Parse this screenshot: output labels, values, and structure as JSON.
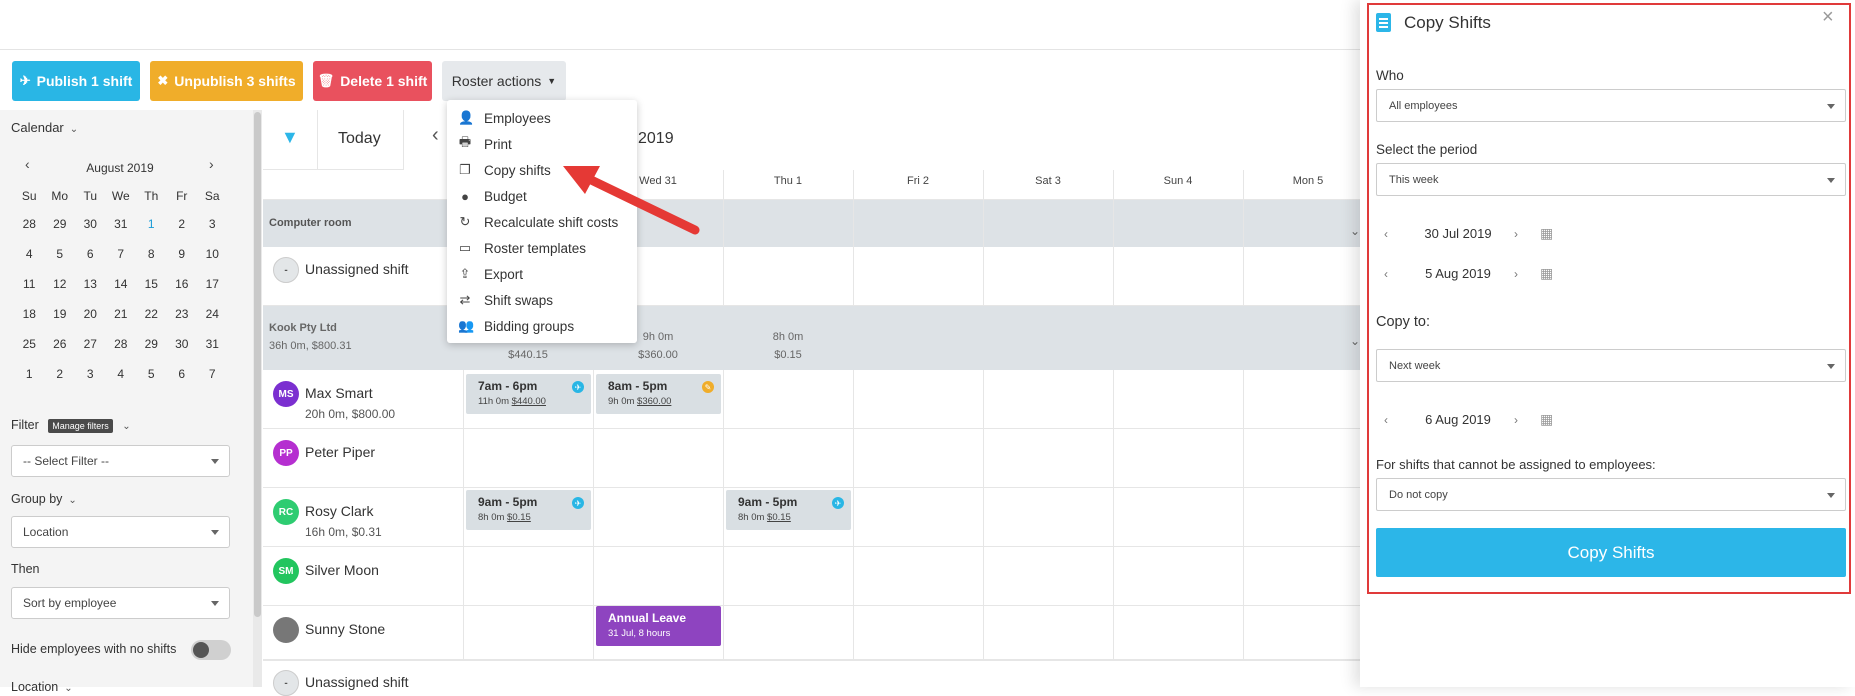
{
  "toolbar": {
    "publish_label": "Publish 1 shift",
    "unpublish_label": "Unpublish 3 shifts",
    "delete_label": "Delete 1 shift",
    "roster_actions_label": "Roster actions",
    "publish_color": "#29b6e5",
    "unpublish_color": "#f0ad2a",
    "delete_color": "#e9515e"
  },
  "roster_menu": {
    "items": [
      {
        "label": "Employees",
        "icon": "employees-icon"
      },
      {
        "label": "Print",
        "icon": "print-icon"
      },
      {
        "label": "Copy shifts",
        "icon": "copy-icon"
      },
      {
        "label": "Budget",
        "icon": "budget-icon"
      },
      {
        "label": "Recalculate shift costs",
        "icon": "refresh-icon"
      },
      {
        "label": "Roster templates",
        "icon": "calendar-icon"
      },
      {
        "label": "Export",
        "icon": "export-icon"
      },
      {
        "label": "Shift swaps",
        "icon": "swap-icon"
      },
      {
        "label": "Bidding groups",
        "icon": "group-icon"
      }
    ]
  },
  "sidebar": {
    "calendar_label": "Calendar",
    "month_label": "August 2019",
    "weekdays": [
      "Su",
      "Mo",
      "Tu",
      "We",
      "Th",
      "Fr",
      "Sa"
    ],
    "weeks": [
      [
        "28",
        "29",
        "30",
        "31",
        "1",
        "2",
        "3"
      ],
      [
        "4",
        "5",
        "6",
        "7",
        "8",
        "9",
        "10"
      ],
      [
        "11",
        "12",
        "13",
        "14",
        "15",
        "16",
        "17"
      ],
      [
        "18",
        "19",
        "20",
        "21",
        "22",
        "23",
        "24"
      ],
      [
        "25",
        "26",
        "27",
        "28",
        "29",
        "30",
        "31"
      ],
      [
        "1",
        "2",
        "3",
        "4",
        "5",
        "6",
        "7"
      ]
    ],
    "filter_label": "Filter",
    "manage_filters_label": "Manage filters",
    "filter_placeholder": "-- Select Filter --",
    "group_by_label": "Group by",
    "group_by_value": "Location",
    "then_label": "Then",
    "then_value": "Sort by employee",
    "hide_employees_label": "Hide employees with no shifts",
    "location_label": "Location"
  },
  "roster": {
    "today_label": "Today",
    "date_range_fragment": "2019",
    "days": [
      "Wed 31",
      "Thu 1",
      "Fri 2",
      "Sat 3",
      "Sun 4",
      "Mon 5"
    ],
    "group1_name": "Computer room",
    "group2_name": "Kook Pty Ltd",
    "group2_summary": "36h 0m, $800.31",
    "group2_totals": [
      {
        "hours": "",
        "cost": "$440.15"
      },
      {
        "hours": "9h 0m",
        "cost": "$360.00"
      },
      {
        "hours": "8h 0m",
        "cost": "$0.15"
      }
    ],
    "unassigned_label": "Unassigned shift",
    "unassigned_avatar": "-",
    "employees": [
      {
        "initials": "MS",
        "name": "Max Smart",
        "summary": "20h 0m, $800.00",
        "color": "#7b2fd0"
      },
      {
        "initials": "PP",
        "name": "Peter Piper",
        "summary": "",
        "color": "#b52fd0"
      },
      {
        "initials": "RC",
        "name": "Rosy Clark",
        "summary": "16h 0m, $0.31",
        "color": "#2ecc71"
      },
      {
        "initials": "SM",
        "name": "Silver Moon",
        "summary": "",
        "color": "#22c55e"
      },
      {
        "initials": "",
        "name": "Sunny Stone",
        "summary": "",
        "color": "#777777"
      }
    ],
    "shifts": {
      "ms1": {
        "time": "7am - 6pm",
        "hours": "11h 0m",
        "cost": "$440.00"
      },
      "ms2": {
        "time": "8am - 5pm",
        "hours": "9h 0m",
        "cost": "$360.00"
      },
      "rc1": {
        "time": "9am - 5pm",
        "hours": "8h 0m",
        "cost": "$0.15"
      },
      "rc2": {
        "time": "9am - 5pm",
        "hours": "8h 0m",
        "cost": "$0.15"
      }
    },
    "leave": {
      "title": "Annual Leave",
      "detail": "31 Jul, 8 hours",
      "color": "#8e44c0"
    }
  },
  "copy_panel": {
    "title": "Copy Shifts",
    "who_label": "Who",
    "who_value": "All employees",
    "period_label": "Select the period",
    "period_value": "This week",
    "start_date": "30 Jul 2019",
    "end_date": "5 Aug 2019",
    "copy_to_label": "Copy to:",
    "copy_to_value": "Next week",
    "copy_to_date": "6 Aug 2019",
    "unassignable_label": "For shifts that cannot be assigned to employees:",
    "unassignable_value": "Do not copy",
    "submit_label": "Copy Shifts",
    "accent_color": "#2cb6e8",
    "highlight_color": "#e03a3a"
  }
}
